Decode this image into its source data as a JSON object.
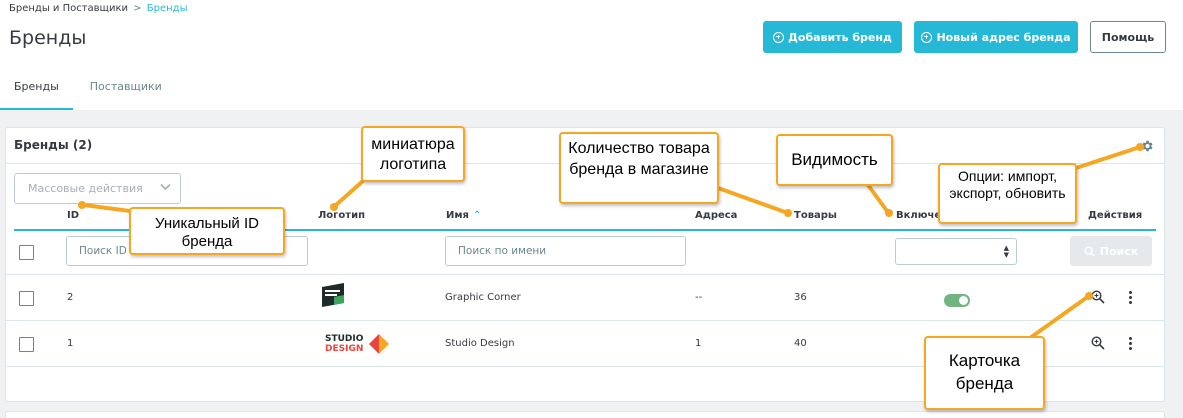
{
  "breadcrumb": {
    "parent": "Бренды и Поставщики",
    "separator": ">",
    "current": "Бренды"
  },
  "page_title": "Бренды",
  "header_buttons": {
    "add_brand": "Добавить бренд",
    "new_address": "Новый адрес бренда",
    "help": "Помощь"
  },
  "tabs": [
    {
      "label": "Бренды",
      "active": true
    },
    {
      "label": "Поставщики",
      "active": false
    }
  ],
  "card": {
    "title": "Бренды (2)",
    "bulk_actions": "Массовые действия",
    "columns": {
      "id": "ID",
      "logo": "Логотип",
      "name": "Имя",
      "addresses": "Адреса",
      "products": "Товары",
      "enabled": "Включен",
      "actions": "Действия"
    },
    "filters": {
      "id_placeholder": "Поиск ID",
      "name_placeholder": "Поиск по имени",
      "search_button": "Поиск"
    },
    "rows": [
      {
        "id": "2",
        "logo": "graphic-corner-logo",
        "name": "Graphic Corner",
        "addresses": "--",
        "products": "36",
        "enabled": true
      },
      {
        "id": "1",
        "logo": "studio-design-logo",
        "logo_text_top": "STUDIO",
        "logo_text_bottom": "DESIGN",
        "name": "Studio Design",
        "addresses": "1",
        "products": "40",
        "enabled": true
      }
    ]
  },
  "callouts": {
    "unique_id": "Уникальный ID бренда",
    "logo_thumb": "миниатюра логотипа",
    "product_count": "Количество товара бренда в магазине",
    "visibility": "Видимость",
    "options": "Опции: импорт, экспорт, обновить",
    "brand_card": "Карточка бренда"
  },
  "colors": {
    "accent": "#25b9d7",
    "callout_border": "#f5a623",
    "toggle_on": "#70b580"
  }
}
